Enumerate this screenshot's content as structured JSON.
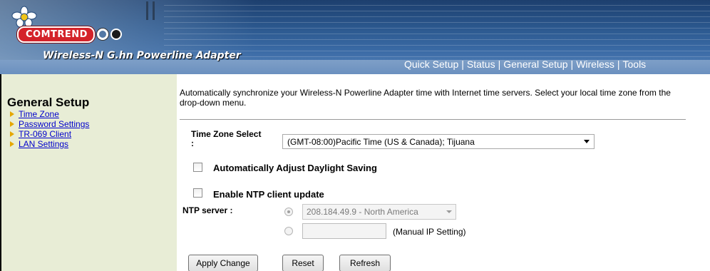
{
  "header": {
    "brand": "COMTREND",
    "product_title": "Wireless-N G.hn Powerline Adapter",
    "nav": [
      "Quick Setup",
      "Status",
      "General Setup",
      "Wireless",
      "Tools"
    ],
    "nav_separator": "|"
  },
  "sidebar": {
    "title": "General Setup",
    "items": [
      {
        "label": "Time Zone"
      },
      {
        "label": "Password Settings"
      },
      {
        "label": "TR-069 Client"
      },
      {
        "label": "LAN Settings"
      }
    ]
  },
  "main": {
    "intro": "Automatically synchronize your Wireless-N Powerline Adapter time with Internet time servers. Select your local time zone from the drop-down menu.",
    "time_zone": {
      "label": "Time Zone Select",
      "label_suffix": ":",
      "value": "(GMT-08:00)Pacific Time (US & Canada); Tijuana"
    },
    "daylight": {
      "label": "Automatically Adjust Daylight Saving",
      "checked": false
    },
    "ntp_enable": {
      "label": "Enable NTP client update",
      "checked": false
    },
    "ntp_server": {
      "label": "NTP server :",
      "preset_value": "208.184.49.9 - North America",
      "manual_value": "",
      "manual_label": "(Manual IP Setting)"
    },
    "buttons": {
      "apply": "Apply Change",
      "reset": "Reset",
      "refresh": "Refresh"
    }
  },
  "colors": {
    "header_blue": "#2a568c",
    "sidebar_bg": "#e8edd6",
    "link": "#0000cc",
    "arrow": "#e5a700",
    "brand_red": "#d4232a"
  }
}
